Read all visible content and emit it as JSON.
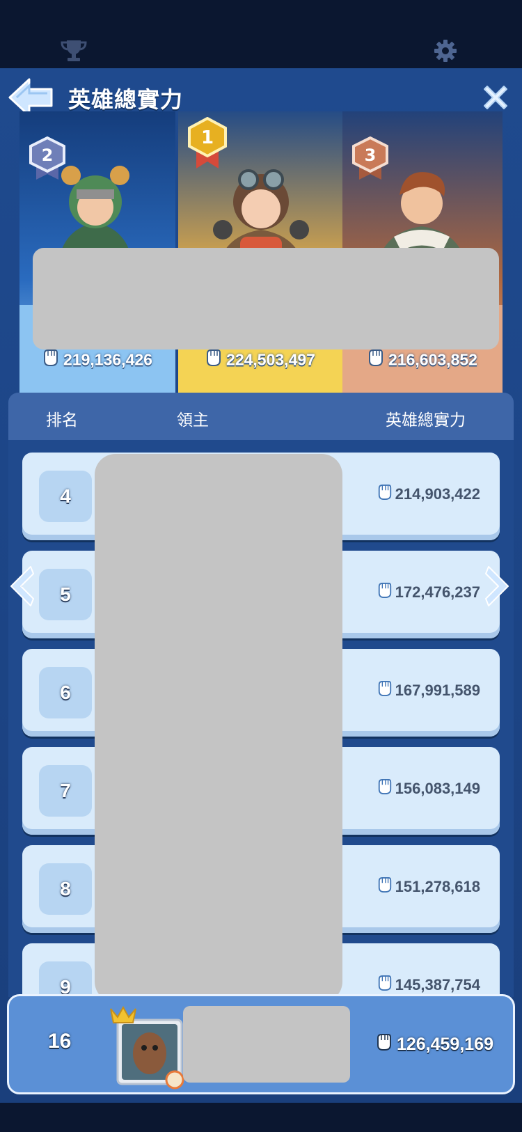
{
  "topbar": {
    "left_icon": "trophy-icon",
    "right_icon": "gear-icon"
  },
  "header": {
    "title": "英雄總實力",
    "back_icon": "back-arrow-icon",
    "close_icon": "close-icon"
  },
  "podium": [
    {
      "rank": "2",
      "score": "219,136,426",
      "medal_color": "#6f7fb8"
    },
    {
      "rank": "1",
      "score": "224,503,497",
      "medal_color": "#e7b021"
    },
    {
      "rank": "3",
      "score": "216,603,852",
      "medal_color": "#c97a58"
    }
  ],
  "table": {
    "col_rank": "排名",
    "col_lord": "領主",
    "col_power": "英雄總實力",
    "rows": [
      {
        "rank": "4",
        "power": "214,903,422"
      },
      {
        "rank": "5",
        "power": "172,476,237"
      },
      {
        "rank": "6",
        "power": "167,991,589"
      },
      {
        "rank": "7",
        "power": "156,083,149"
      },
      {
        "rank": "8",
        "power": "151,278,618"
      },
      {
        "rank": "9",
        "power": "145,387,754"
      }
    ]
  },
  "self": {
    "rank": "16",
    "power": "126,459,169"
  },
  "colors": {
    "panel": "#1f4a8e",
    "row": "#d9ebfb",
    "self_row": "#5b90d6"
  }
}
